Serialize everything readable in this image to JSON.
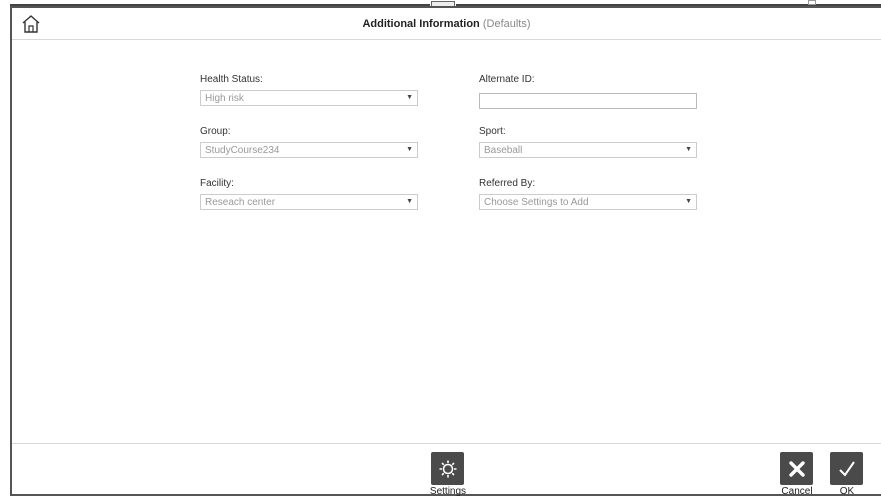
{
  "header": {
    "title": "Additional Information",
    "subtitle": "(Defaults)"
  },
  "form": {
    "health_status": {
      "label": "Health Status:",
      "value": "High risk"
    },
    "alternate_id": {
      "label": "Alternate ID:",
      "value": ""
    },
    "group": {
      "label": "Group:",
      "value": "StudyCourse234"
    },
    "sport": {
      "label": "Sport:",
      "value": "Baseball"
    },
    "facility": {
      "label": "Facility:",
      "value": "Reseach center"
    },
    "referred_by": {
      "label": "Referred By:",
      "value": "Choose Settings to Add"
    }
  },
  "footer": {
    "settings_label": "Settings",
    "cancel_label": "Cancel",
    "ok_label": "OK"
  },
  "icons": {
    "home": "home-icon",
    "settings": "gear-icon",
    "cancel": "close-icon",
    "ok": "checkmark-icon",
    "dropdown": "caret-down-icon"
  },
  "colors": {
    "button_bg": "#4a4a4a",
    "border": "#d8d8d8"
  }
}
